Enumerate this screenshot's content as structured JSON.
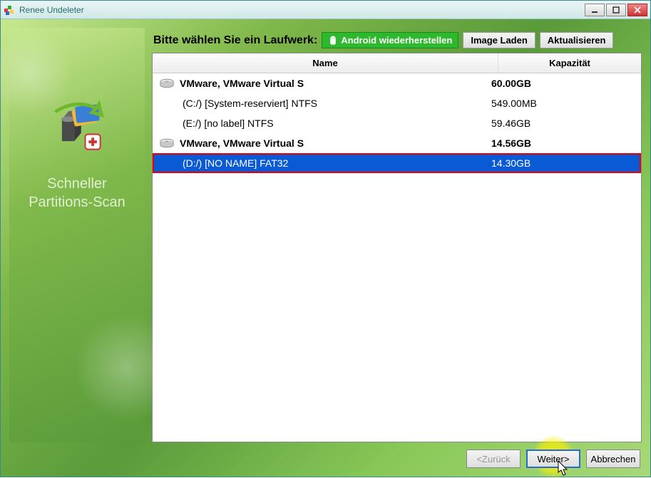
{
  "window": {
    "title": "Renee Undeleter"
  },
  "sidebar": {
    "label_line1": "Schneller",
    "label_line2": "Partitions-Scan"
  },
  "topbar": {
    "prompt": "Bitte wählen Sie ein Laufwerk:",
    "android_label": "Android wiederherstellen",
    "image_load_label": "Image Laden",
    "refresh_label": "Aktualisieren"
  },
  "columns": {
    "name": "Name",
    "capacity": "Kapazität"
  },
  "drives": [
    {
      "type": "disk",
      "name": "VMware, VMware Virtual S",
      "capacity": "60.00GB",
      "selected": false
    },
    {
      "type": "partition",
      "name": "(C:/) [System-reserviert] NTFS",
      "capacity": "549.00MB",
      "selected": false
    },
    {
      "type": "partition",
      "name": "(E:/) [no label] NTFS",
      "capacity": "59.46GB",
      "selected": false
    },
    {
      "type": "disk",
      "name": "VMware, VMware Virtual S",
      "capacity": "14.56GB",
      "selected": false
    },
    {
      "type": "partition",
      "name": "(D:/) [NO NAME] FAT32",
      "capacity": "14.30GB",
      "selected": true
    }
  ],
  "footer": {
    "back": "<Zurück",
    "next": "Weiter>",
    "cancel": "Abbrechen"
  }
}
